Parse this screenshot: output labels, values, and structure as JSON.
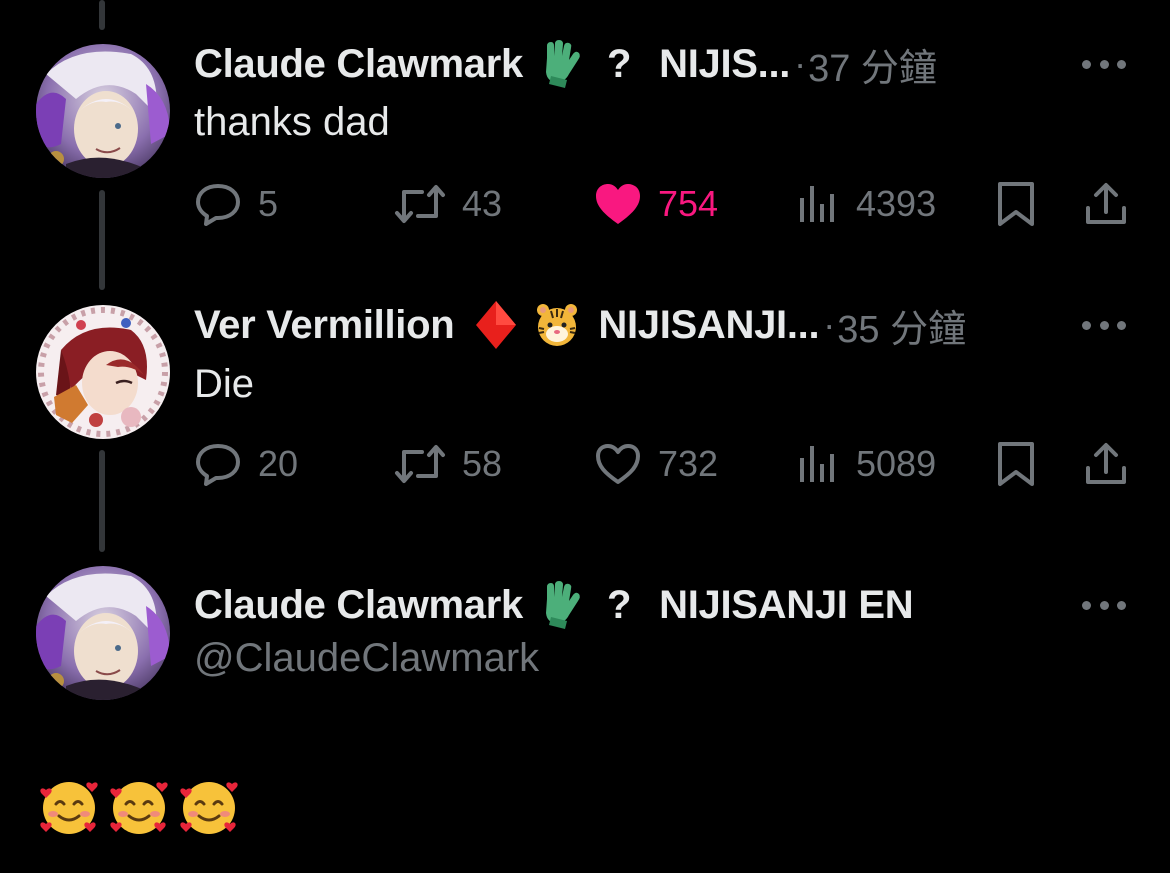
{
  "tweets": [
    {
      "display_name": "Claude Clawmark",
      "badge_icon": "glove-icon",
      "org_badge": "?",
      "org_name": "NIJIS...",
      "meta_dot": "·",
      "timestamp": "37 分鐘",
      "text": "thanks dad",
      "replies": "5",
      "retweets": "43",
      "likes": "754",
      "liked": true,
      "views": "4393"
    },
    {
      "display_name": "Ver Vermillion",
      "badge_icon": "red-diamond-icon",
      "org_badge": "tiger-face-icon",
      "org_name": "NIJISANJI...",
      "meta_dot": "·",
      "timestamp": "35 分鐘",
      "text": "Die",
      "replies": "20",
      "retweets": "58",
      "likes": "732",
      "liked": false,
      "views": "5089"
    }
  ],
  "main_tweet": {
    "display_name": "Claude Clawmark",
    "badge_icon": "glove-icon",
    "org_badge": "?",
    "org_name": "NIJISANJI EN",
    "handle": "@ClaudeClawmark",
    "emojis": [
      "smiling-face-with-hearts-icon",
      "smiling-face-with-hearts-icon",
      "smiling-face-with-hearts-icon"
    ]
  },
  "colors": {
    "background": "#000000",
    "text_primary": "#e7e9ea",
    "text_secondary": "#71767b",
    "like_pink": "#f91880",
    "thread_line": "#333639"
  }
}
